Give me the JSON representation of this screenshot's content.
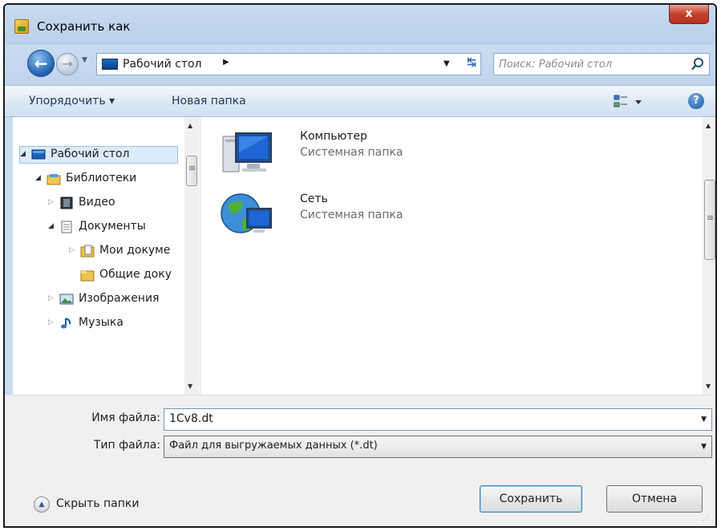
{
  "window": {
    "title": "Сохранить как",
    "close_label": "x"
  },
  "address": {
    "location": "Рабочий стол",
    "search_placeholder": "Поиск: Рабочий стол"
  },
  "toolbar": {
    "organize_label": "Упорядочить ▾",
    "new_folder_label": "Новая папка"
  },
  "nav_tree": {
    "items": [
      {
        "label": "Рабочий стол",
        "expanded": true,
        "selected": true,
        "icon": "desktop-icon"
      },
      {
        "label": "Библиотеки",
        "expanded": true,
        "icon": "libraries-icon"
      },
      {
        "label": "Видео",
        "expanded": false,
        "icon": "video-icon"
      },
      {
        "label": "Документы",
        "expanded": true,
        "icon": "documents-icon"
      },
      {
        "label": "Мои докуме",
        "expanded": false,
        "icon": "folder-doc-icon"
      },
      {
        "label": "Общие доку",
        "icon": "folder-icon"
      },
      {
        "label": "Изображения",
        "expanded": false,
        "icon": "images-icon"
      },
      {
        "label": "Музыка",
        "expanded": false,
        "icon": "music-icon"
      }
    ]
  },
  "files": [
    {
      "name": "Компьютер",
      "type": "Системная папка",
      "icon": "computer-icon"
    },
    {
      "name": "Сеть",
      "type": "Системная папка",
      "icon": "network-icon"
    }
  ],
  "form": {
    "filename_label": "Имя файла:",
    "filename_value": "1Cv8.dt",
    "filetype_label": "Тип файла:",
    "filetype_value": "Файл для выгружаемых данных (*.dt)"
  },
  "footer": {
    "hide_folders_label": "Скрыть папки",
    "save_label": "Сохранить",
    "cancel_label": "Отмена"
  }
}
